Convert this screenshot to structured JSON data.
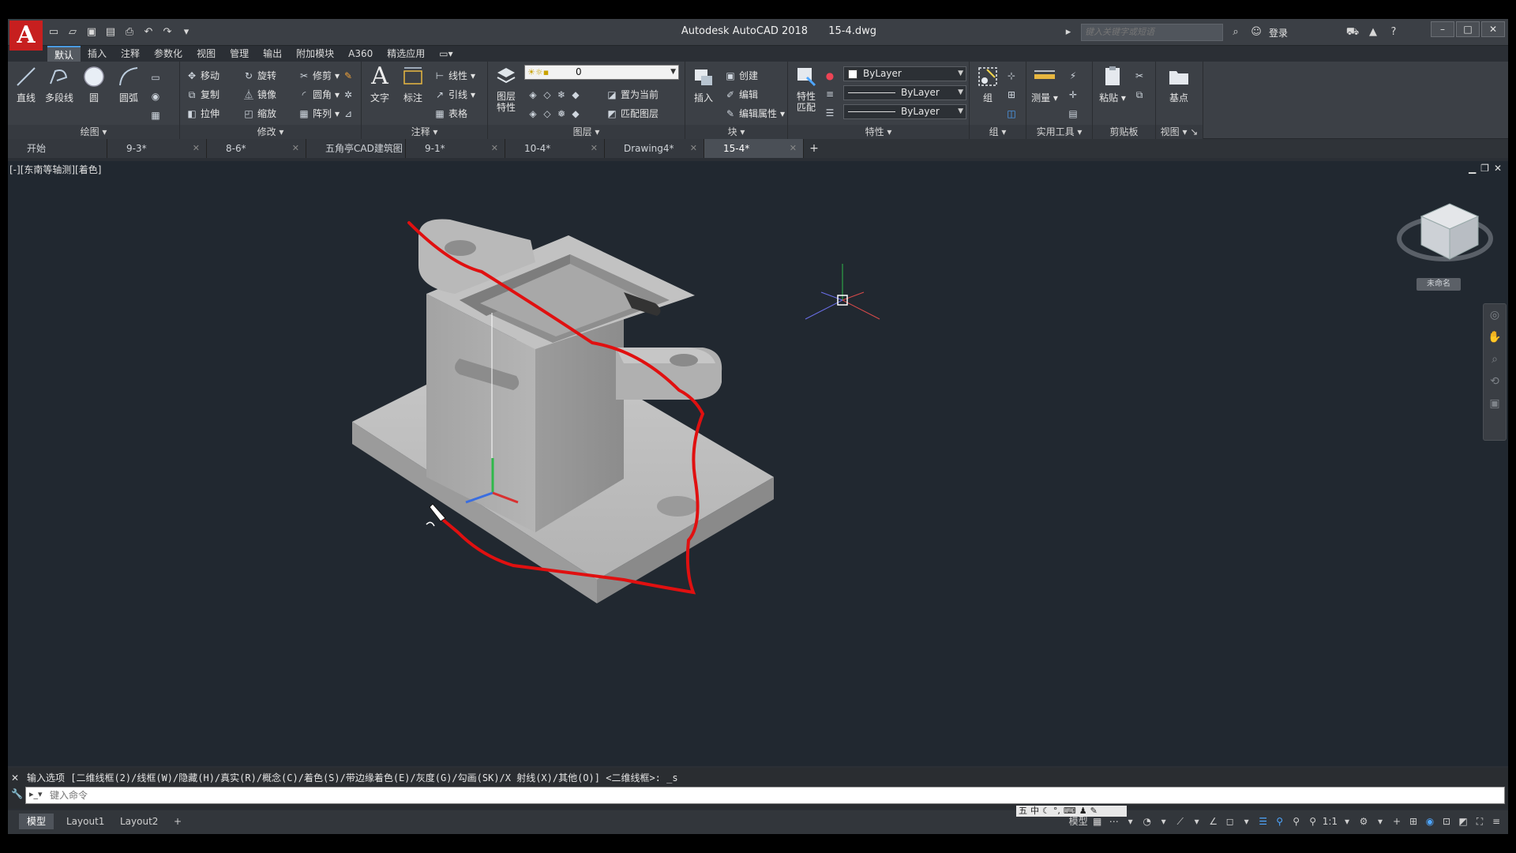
{
  "title": {
    "app": "Autodesk AutoCAD 2018",
    "file": "15-4.dwg"
  },
  "app_logo": "A",
  "search": {
    "placeholder": "键入关键字或短语"
  },
  "user": {
    "login": "登录"
  },
  "ribbon_tabs": [
    "默认",
    "插入",
    "注释",
    "参数化",
    "视图",
    "管理",
    "输出",
    "附加模块",
    "A360",
    "精选应用"
  ],
  "ribbon": {
    "draw": {
      "title": "绘图",
      "line": "直线",
      "polyline": "多段线",
      "circle": "圆",
      "arc": "圆弧"
    },
    "modify": {
      "title": "修改",
      "move": "移动",
      "rotate": "旋转",
      "trim": "修剪",
      "copy": "复制",
      "mirror": "镜像",
      "fillet": "圆角",
      "stretch": "拉伸",
      "scale": "缩放",
      "array": "阵列"
    },
    "annotation": {
      "title": "注释",
      "text": "文字",
      "dimension": "标注",
      "linear": "线性",
      "leader": "引线",
      "table": "表格"
    },
    "layers": {
      "title": "图层",
      "layer_props": "图层\n特性",
      "current_layer": "0",
      "set_current": "置为当前",
      "match_layer": "匹配图层"
    },
    "block": {
      "title": "块",
      "insert": "插入",
      "create": "创建",
      "edit": "编辑",
      "edit_attr": "编辑属性"
    },
    "properties": {
      "title": "特性",
      "match": "特性\n匹配",
      "color": "ByLayer",
      "linetype": "ByLayer",
      "lineweight": "ByLayer"
    },
    "groups": {
      "title": "组",
      "group": "组"
    },
    "utilities": {
      "title": "实用工具",
      "measure": "测量"
    },
    "clipboard": {
      "title": "剪贴板",
      "paste": "粘贴"
    },
    "view": {
      "title": "视图",
      "base": "基点"
    }
  },
  "file_tabs": [
    "开始",
    "9-3*",
    "8-6*",
    "五角亭CAD建筑图纸*",
    "9-1*",
    "10-4*",
    "Drawing4*",
    "15-4*"
  ],
  "viewport": {
    "label": "[-][东南等轴测][着色]",
    "unnamed": "未命名"
  },
  "command": {
    "history": "输入选项 [二维线框(2)/线框(W)/隐藏(H)/真实(R)/概念(C)/着色(S)/带边缘着色(E)/灰度(G)/勾画(SK)/X 射线(X)/其他(O)] <二维线框>: _s",
    "placeholder": "键入命令"
  },
  "layout_tabs": [
    "模型",
    "Layout1",
    "Layout2"
  ],
  "status": {
    "model": "模型",
    "scale": "1:1"
  },
  "ime": [
    "五",
    "中"
  ],
  "colors": {
    "accent": "#4ea6ff",
    "logo": "#c71f1f",
    "viewport_bg": "#212830",
    "annotation": "#e01010"
  }
}
